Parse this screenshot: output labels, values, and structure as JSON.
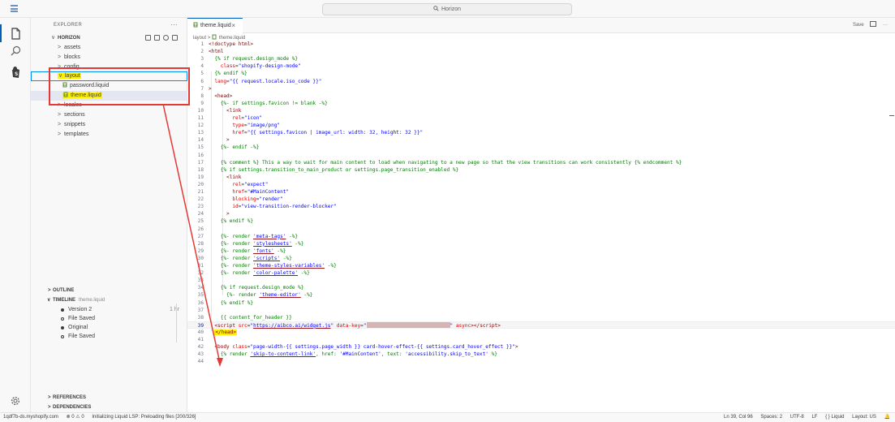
{
  "titlebar": {
    "search_text": "Horizon"
  },
  "sidebar": {
    "header": "EXPLORER",
    "more": "···",
    "root": "HORIZON",
    "items": [
      {
        "label": "assets",
        "chev": ">"
      },
      {
        "label": "blocks",
        "chev": ">"
      },
      {
        "label": "config",
        "chev": ">"
      },
      {
        "label": "layout",
        "chev": "∨"
      },
      {
        "label": "password.liquid"
      },
      {
        "label": "theme.liquid"
      },
      {
        "label": "locales",
        "chev": ">"
      },
      {
        "label": "sections",
        "chev": ">"
      },
      {
        "label": "snippets",
        "chev": ">"
      },
      {
        "label": "templates",
        "chev": ">"
      }
    ],
    "outline": "OUTLINE",
    "timeline": "TIMELINE",
    "timeline_file": "theme.liquid",
    "timeline_items": [
      {
        "label": "Version 2",
        "time": "1 hr"
      },
      {
        "label": "File Saved",
        "time": ""
      },
      {
        "label": "Original",
        "time": ""
      },
      {
        "label": "File Saved",
        "time": ""
      }
    ],
    "references": "REFERENCES",
    "dependencies": "DEPENDENCIES"
  },
  "editor": {
    "tab_label": "theme.liquid",
    "tab_close": "×",
    "save_label": "Save",
    "more": "···",
    "breadcrumb_folder": "layout",
    "breadcrumb_sep": ">",
    "breadcrumb_file": "theme.liquid"
  },
  "code_lines": [
    "1",
    "2",
    "3",
    "4",
    "5",
    "6",
    "7",
    "8",
    "9",
    "10",
    "11",
    "12",
    "13",
    "14",
    "15",
    "16",
    "17",
    "18",
    "19",
    "20",
    "21",
    "22",
    "23",
    "24",
    "25",
    "26",
    "27",
    "28",
    "29",
    "30",
    "31",
    "32",
    "33",
    "34",
    "35",
    "36",
    "37",
    "38",
    "39",
    "40",
    "41",
    "42",
    "43",
    "44"
  ],
  "statusbar": {
    "remote": "1qdf7b-ds.myshopify.com",
    "problems": "⊗ 0 ⚠ 0",
    "lsp": "Initializing Liquid LSP: Preloading files [200/326]",
    "position": "Ln 39, Col 96",
    "spaces": "Spaces: 2",
    "encoding": "UTF-8",
    "eol": "LF",
    "language": "{ } Liquid",
    "layout": "Layout: US"
  },
  "colors": {
    "accent": "#005fb8",
    "annotation": "#e53935",
    "highlight": "#ffef00"
  }
}
